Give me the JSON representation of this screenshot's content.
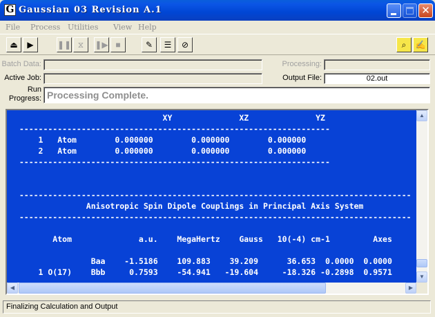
{
  "window": {
    "title": "Gaussian 03 Revision A.1",
    "app_icon_letter": "G"
  },
  "menu": [
    "File",
    "Process",
    "Utilities",
    "View",
    "Help"
  ],
  "toolbar": {
    "icons": [
      "eject-icon",
      "play-icon",
      "pause-icon",
      "pause-after-link-icon",
      "skip-link-icon",
      "stop-icon",
      "edit-batch-icon",
      "batch-list-icon",
      "delete-batch-icon",
      "view-output-icon",
      "edit-input-icon"
    ]
  },
  "info": {
    "batch_data_label": "Batch Data:",
    "batch_data_value": "",
    "processing_label": "Processing:",
    "processing_value": "",
    "active_job_label": "Active Job:",
    "active_job_value": "",
    "output_file_label": "Output File:",
    "output_file_value": "02.out",
    "run_progress_label_1": "Run",
    "run_progress_label_2": "Progress:",
    "run_progress_value": "Processing Complete."
  },
  "output_lines": [
    "                                XY              XZ              YZ",
    "  -----------------------------------------------------------------",
    "      1   Atom        0.000000        0.000000        0.000000",
    "      2   Atom        0.000000        0.000000        0.000000",
    "  -----------------------------------------------------------------",
    "",
    "",
    "  ----------------------------------------------------------------------------------",
    "                Anisotropic Spin Dipole Couplings in Principal Axis System",
    "  ----------------------------------------------------------------------------------",
    "",
    "",
    "         Atom              a.u.    MegaHertz    Gauss   10(-4) cm-1         Axes",
    "",
    "",
    "                 Baa    -1.5186    109.883    39.209      36.653  0.0000  0.0000",
    "      1 O(17)    Bbb     0.7593    -54.941   -19.604     -18.326 -0.2898  0.9571"
  ],
  "status": {
    "text": "Finalizing Calculation and Output"
  },
  "colors": {
    "output_bg": "#0842d6",
    "titlebar": "#0054e3"
  }
}
